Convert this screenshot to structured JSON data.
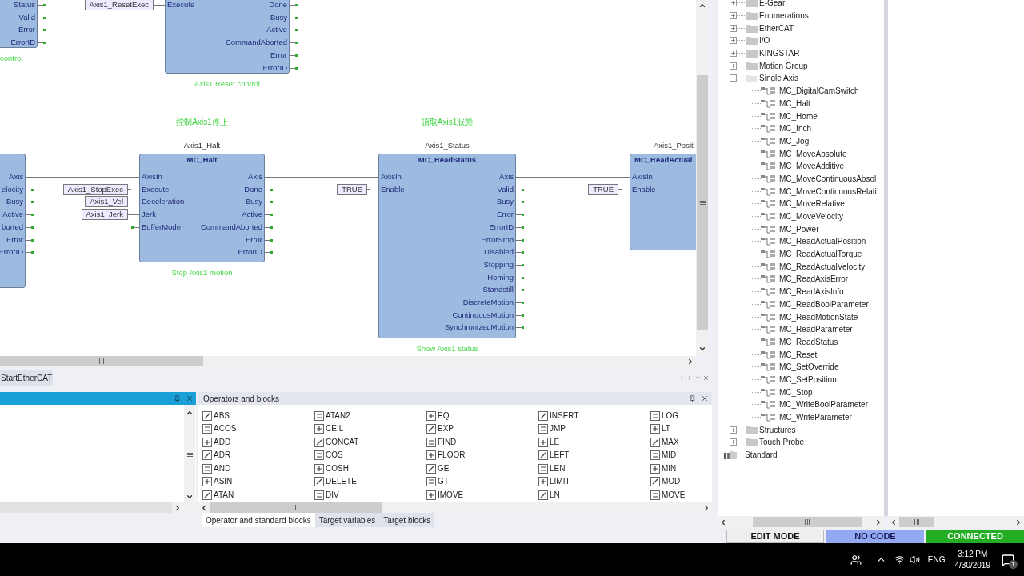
{
  "diagram": {
    "blocks": [
      {
        "kind": "partial",
        "outputs": [
          {
            "name": "Status",
            "connected": false
          },
          {
            "name": "Valid",
            "connected": false
          },
          {
            "name": "Error",
            "connected": false
          },
          {
            "name": "ErrorID",
            "connected": false
          }
        ],
        "comment": "control"
      },
      {
        "kind": "block",
        "inputs": [
          {
            "name": "Execute",
            "connected": true,
            "variable": "Axis1_ResetExec"
          }
        ],
        "outputs": [
          {
            "name": "Done",
            "connected": false
          },
          {
            "name": "Busy",
            "connected": false
          },
          {
            "name": "Active",
            "connected": false
          },
          {
            "name": "CommandAborted",
            "connected": false
          },
          {
            "name": "Error",
            "connected": false
          },
          {
            "name": "ErrorID",
            "connected": false
          }
        ],
        "comment": "Axis1 Reset control"
      },
      {
        "kind": "partial",
        "outputs": [
          {
            "name": "Axis",
            "connected": true
          },
          {
            "name": "elocity",
            "connected": false
          },
          {
            "name": "Busy",
            "connected": false
          },
          {
            "name": "Active",
            "connected": false
          },
          {
            "name": "borted",
            "connected": false
          },
          {
            "name": "Error",
            "connected": false
          },
          {
            "name": "ErrorID",
            "connected": false
          }
        ]
      },
      {
        "kind": "block",
        "heading": "控制Axis1停止",
        "instance": "Axis1_Halt",
        "type": "MC_Halt",
        "inputs": [
          {
            "name": "AxisIn",
            "connected": true
          },
          {
            "name": "Execute",
            "connected": true,
            "variable": "Axis1_StopExec"
          },
          {
            "name": "Deceleration",
            "connected": true,
            "variable": "Axis1_Vel"
          },
          {
            "name": "Jerk",
            "connected": true,
            "variable": "Axis1_Jerk"
          },
          {
            "name": "BufferMode",
            "connected": false
          }
        ],
        "outputs": [
          {
            "name": "Axis",
            "connected": true
          },
          {
            "name": "Done",
            "connected": false
          },
          {
            "name": "Busy",
            "connected": false
          },
          {
            "name": "Active",
            "connected": false
          },
          {
            "name": "CommandAborted",
            "connected": false
          },
          {
            "name": "Error",
            "connected": false
          },
          {
            "name": "ErrorID",
            "connected": false
          }
        ],
        "comment": "Stop Axis1 motion"
      },
      {
        "kind": "block",
        "heading": "讀取Axis1狀態",
        "instance": "Axis1_Status",
        "type": "MC_ReadStatus",
        "inputs": [
          {
            "name": "AxisIn",
            "connected": true
          },
          {
            "name": "Enable",
            "connected": true,
            "variable": "TRUE"
          }
        ],
        "outputs": [
          {
            "name": "Axis",
            "connected": true
          },
          {
            "name": "Valid",
            "connected": false
          },
          {
            "name": "Busy",
            "connected": false
          },
          {
            "name": "Error",
            "connected": false
          },
          {
            "name": "ErrorID",
            "connected": false
          },
          {
            "name": "ErrorStop",
            "connected": false
          },
          {
            "name": "Disabled",
            "connected": false
          },
          {
            "name": "Stopping",
            "connected": false
          },
          {
            "name": "Homing",
            "connected": false
          },
          {
            "name": "Standstill",
            "connected": false
          },
          {
            "name": "DiscreteMotion",
            "connected": false
          },
          {
            "name": "ContinuousMotion",
            "connected": false
          },
          {
            "name": "SynchronizedMotion",
            "connected": false
          }
        ],
        "comment": "Show Axis1 status"
      },
      {
        "kind": "block",
        "instance": "Axis1_Posit",
        "type": "MC_ReadActual",
        "inputs": [
          {
            "name": "AxisIn",
            "connected": true
          },
          {
            "name": "Enable",
            "connected": true,
            "variable": "TRUE"
          }
        ]
      }
    ]
  },
  "document_tabs": [
    {
      "label": "StartEtherCAT",
      "selected": true
    }
  ],
  "operators_panel": {
    "title": "Operators and blocks",
    "items": [
      "ABS",
      "ACOS",
      "ADD",
      "ADR",
      "AND",
      "ASIN",
      "ATAN",
      "ATAN2",
      "CEIL",
      "CONCAT",
      "COS",
      "COSH",
      "DELETE",
      "DIV",
      "EQ",
      "EXP",
      "FIND",
      "FLOOR",
      "GE",
      "GT",
      "IMOVE",
      "INSERT",
      "JMP",
      "LE",
      "LEFT",
      "LEN",
      "LIMIT",
      "LN",
      "LOG",
      "LT",
      "MAX",
      "MID",
      "MIN",
      "MOD",
      "MOVE"
    ],
    "tabs": [
      {
        "label": "Operator and standard blocks",
        "selected": true
      },
      {
        "label": "Target variables",
        "selected": false
      },
      {
        "label": "Target blocks",
        "selected": false
      }
    ]
  },
  "library_tree": {
    "items": [
      {
        "label": "E-Gear",
        "expanded": false
      },
      {
        "label": "Enumerations",
        "expanded": false
      },
      {
        "label": "EtherCAT",
        "expanded": false
      },
      {
        "label": "I/O",
        "expanded": false
      },
      {
        "label": "KINGSTAR",
        "expanded": false
      },
      {
        "label": "Motion Group",
        "expanded": false
      },
      {
        "label": "Single Axis",
        "expanded": true,
        "children": [
          {
            "label": "MC_DigitalCamSwitch"
          },
          {
            "label": "MC_Halt"
          },
          {
            "label": "MC_Home"
          },
          {
            "label": "MC_Inch"
          },
          {
            "label": "MC_Jog"
          },
          {
            "label": "MC_MoveAbsolute"
          },
          {
            "label": "MC_MoveAdditive"
          },
          {
            "label": "MC_MoveContinuousAbsol"
          },
          {
            "label": "MC_MoveContinuousRelati"
          },
          {
            "label": "MC_MoveRelative"
          },
          {
            "label": "MC_MoveVelocity"
          },
          {
            "label": "MC_Power"
          },
          {
            "label": "MC_ReadActualPosition"
          },
          {
            "label": "MC_ReadActualTorque"
          },
          {
            "label": "MC_ReadActualVelocity"
          },
          {
            "label": "MC_ReadAxisError"
          },
          {
            "label": "MC_ReadAxisInfo"
          },
          {
            "label": "MC_ReadBoolParameter"
          },
          {
            "label": "MC_ReadMotionState"
          },
          {
            "label": "MC_ReadParameter"
          },
          {
            "label": "MC_ReadStatus"
          },
          {
            "label": "MC_Reset"
          },
          {
            "label": "MC_SetOverride"
          },
          {
            "label": "MC_SetPosition"
          },
          {
            "label": "MC_Stop"
          },
          {
            "label": "MC_WriteBoolParameter"
          },
          {
            "label": "MC_WriteParameter"
          }
        ]
      },
      {
        "label": "Structures",
        "expanded": false
      },
      {
        "label": "Touch Probe",
        "expanded": false
      }
    ],
    "next_library": {
      "label": "Standard"
    }
  },
  "status_bar": [
    {
      "kind": "mode",
      "label": "EDIT MODE"
    },
    {
      "kind": "code",
      "label": "NO CODE"
    },
    {
      "kind": "connection",
      "label": "CONNECTED"
    }
  ],
  "taskbar": {
    "language": "ENG",
    "time": "3:12 PM",
    "date": "4/30/2019",
    "notifications": "1"
  }
}
